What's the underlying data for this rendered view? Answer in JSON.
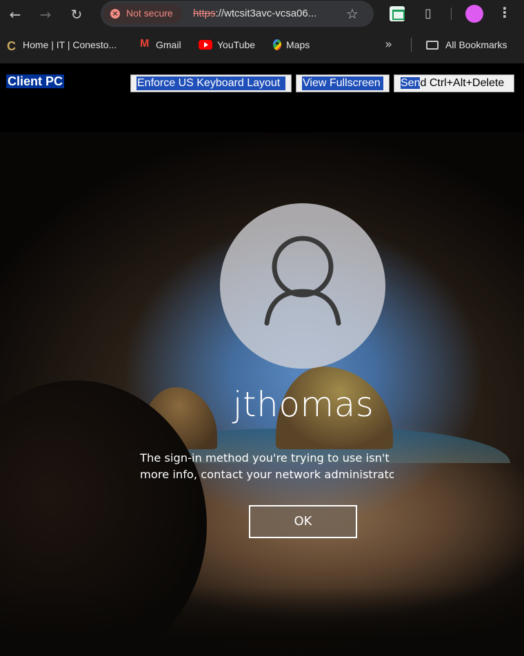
{
  "browser": {
    "security_label": "Not secure",
    "url_scheme": "https",
    "url_rest": "://wtcsit3avc-vcsa06...",
    "accent_warning": "#f28b82"
  },
  "bookmarks": {
    "items": [
      {
        "label": "Home | IT | Conesto...",
        "icon": "conestoga-icon"
      },
      {
        "label": "Gmail",
        "icon": "gmail-icon"
      },
      {
        "label": "YouTube",
        "icon": "youtube-icon"
      },
      {
        "label": "Maps",
        "icon": "maps-icon"
      }
    ],
    "overflow_icon": "chevron-double-right-icon",
    "all_bookmarks": "All Bookmarks"
  },
  "viewer": {
    "title": "Client PC",
    "buttons": {
      "keyboard": "Enforce US Keyboard Layout",
      "fullscreen": "View Fullscreen",
      "cad_highlight": "Sen",
      "cad_rest": "d Ctrl+Alt+Delete"
    }
  },
  "login": {
    "username": "jthomas",
    "message_line1": "The sign-in method you're trying to use isn't",
    "message_line2": "more info, contact your network administrato",
    "ok_label": "OK"
  }
}
